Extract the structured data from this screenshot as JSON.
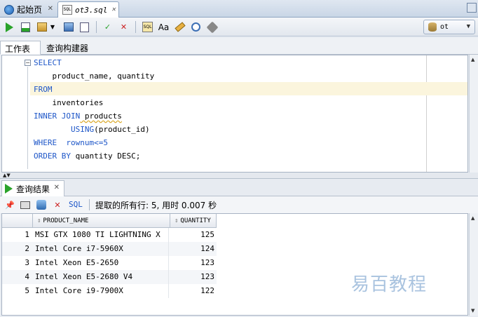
{
  "tabs": [
    {
      "label": "起始页",
      "icon": "globe-icon"
    },
    {
      "label": "ot3.sql",
      "icon": "sql-file-icon"
    }
  ],
  "toolbar": {
    "connection": "ot",
    "icons": [
      "run-statement-icon",
      "run-script-icon",
      "commit-icon",
      "dropdown-icon",
      "rollback-icon",
      "explain-plan-icon",
      "autotrace-icon",
      "sql-tuning-icon",
      "format-case-icon",
      "eraser-icon",
      "history-icon",
      "tools-icon"
    ]
  },
  "worksheet_tabs": [
    "工作表",
    "查询构建器"
  ],
  "editor": {
    "lines": [
      {
        "kw": "SELECT",
        "text": ""
      },
      {
        "kw": "",
        "text": "    product_name, quantity"
      },
      {
        "kw": "FROM",
        "text": ""
      },
      {
        "kw": "",
        "text": "    inventories"
      },
      {
        "kw": "INNER JOIN",
        "text": " products"
      },
      {
        "kw": "        USING",
        "text": "(product_id)"
      },
      {
        "kw": "WHERE",
        "text": "  rownum<=5"
      },
      {
        "kw": "ORDER BY",
        "text": " quantity DESC;"
      }
    ]
  },
  "results": {
    "tab_label": "查询结果",
    "sql_label": "SQL",
    "status": "提取的所有行: 5, 用时 0.007 秒",
    "columns": [
      "PRODUCT_NAME",
      "QUANTITY"
    ],
    "rows": [
      {
        "n": "1",
        "product_name": "MSI GTX 1080 TI LIGHTNING X",
        "quantity": "125"
      },
      {
        "n": "2",
        "product_name": "Intel Core i7-5960X",
        "quantity": "124"
      },
      {
        "n": "3",
        "product_name": "Intel Xeon E5-2650",
        "quantity": "123"
      },
      {
        "n": "4",
        "product_name": "Intel Xeon E5-2680 V4",
        "quantity": "123"
      },
      {
        "n": "5",
        "product_name": "Intel Core i9-7900X",
        "quantity": "122"
      }
    ],
    "watermark": "易百教程"
  }
}
